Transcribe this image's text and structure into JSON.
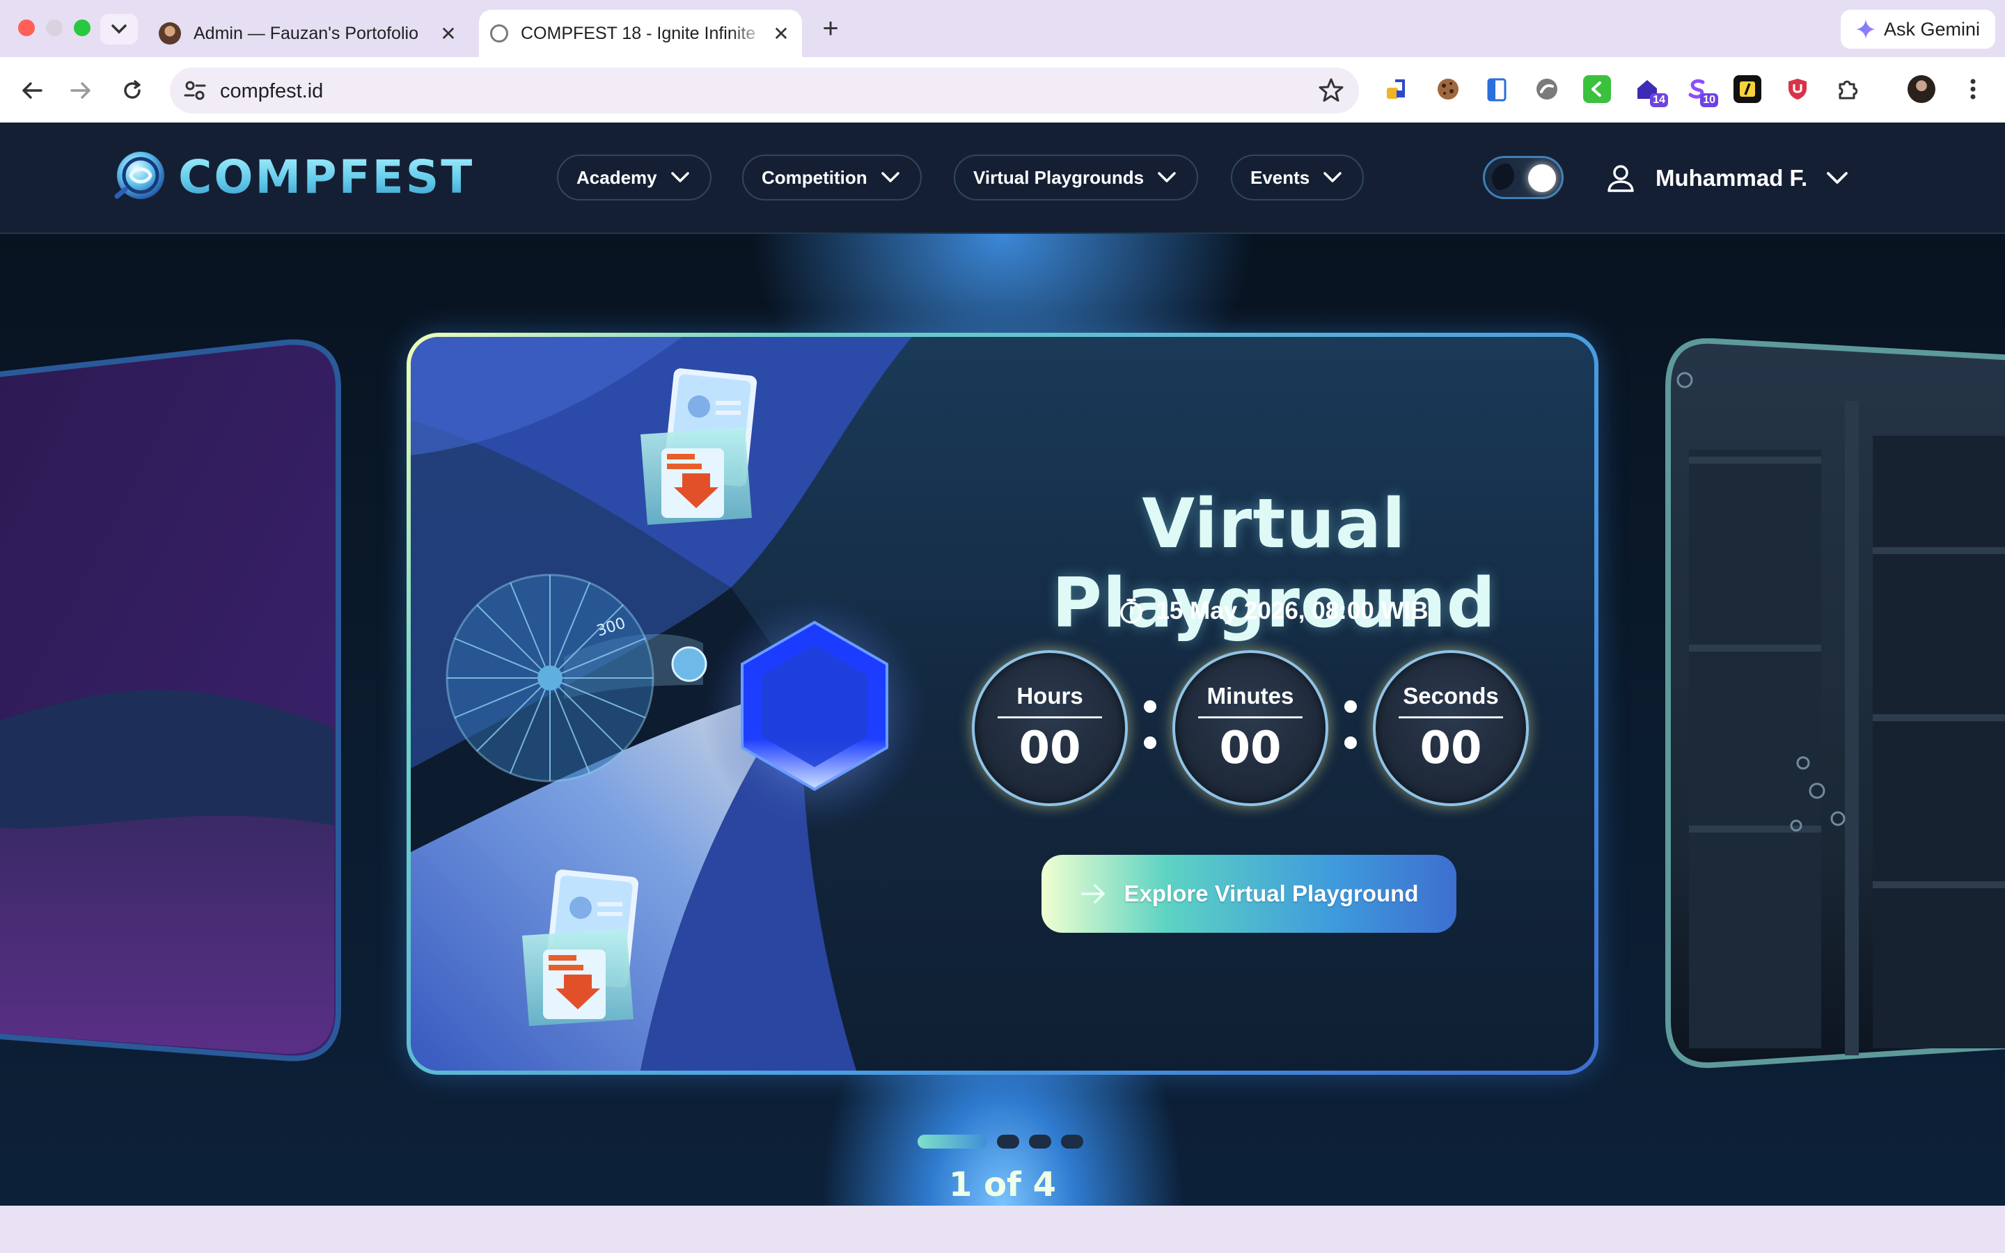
{
  "browser": {
    "tabs": [
      {
        "title": "Admin — Fauzan's Portofolio",
        "active": false
      },
      {
        "title": "COMPFEST 18 - Ignite Infinite",
        "active": true
      }
    ],
    "new_tab": "+",
    "close_glyph": "✕",
    "gemini_label": "Ask Gemini",
    "url": "compfest.id",
    "extension_badges": {
      "ext_a": "14",
      "ext_b": "10"
    }
  },
  "site": {
    "logo_text": "COMPFEST",
    "nav": [
      {
        "label": "Academy"
      },
      {
        "label": "Competition"
      },
      {
        "label": "Virtual Playgrounds"
      },
      {
        "label": "Events"
      }
    ],
    "user_name": "Muhammad F.",
    "theme_toggle": {
      "state": "dark"
    }
  },
  "slide": {
    "title": "Virtual Playground",
    "date": "15 May 2026, 08:00 WIB",
    "countdown": [
      {
        "label": "Hours",
        "value": "00"
      },
      {
        "label": "Minutes",
        "value": "00"
      },
      {
        "label": "Seconds",
        "value": "00"
      }
    ],
    "cta_label": "Explore Virtual Playground",
    "wheel_label": "300",
    "position": "1 of 4",
    "current": 1,
    "total": 4
  },
  "colors": {
    "nav_bg": "#151f33",
    "accent_cyan": "#5ed3c3",
    "accent_blue": "#3d6fd0",
    "hexagon": "#1f3fff"
  }
}
